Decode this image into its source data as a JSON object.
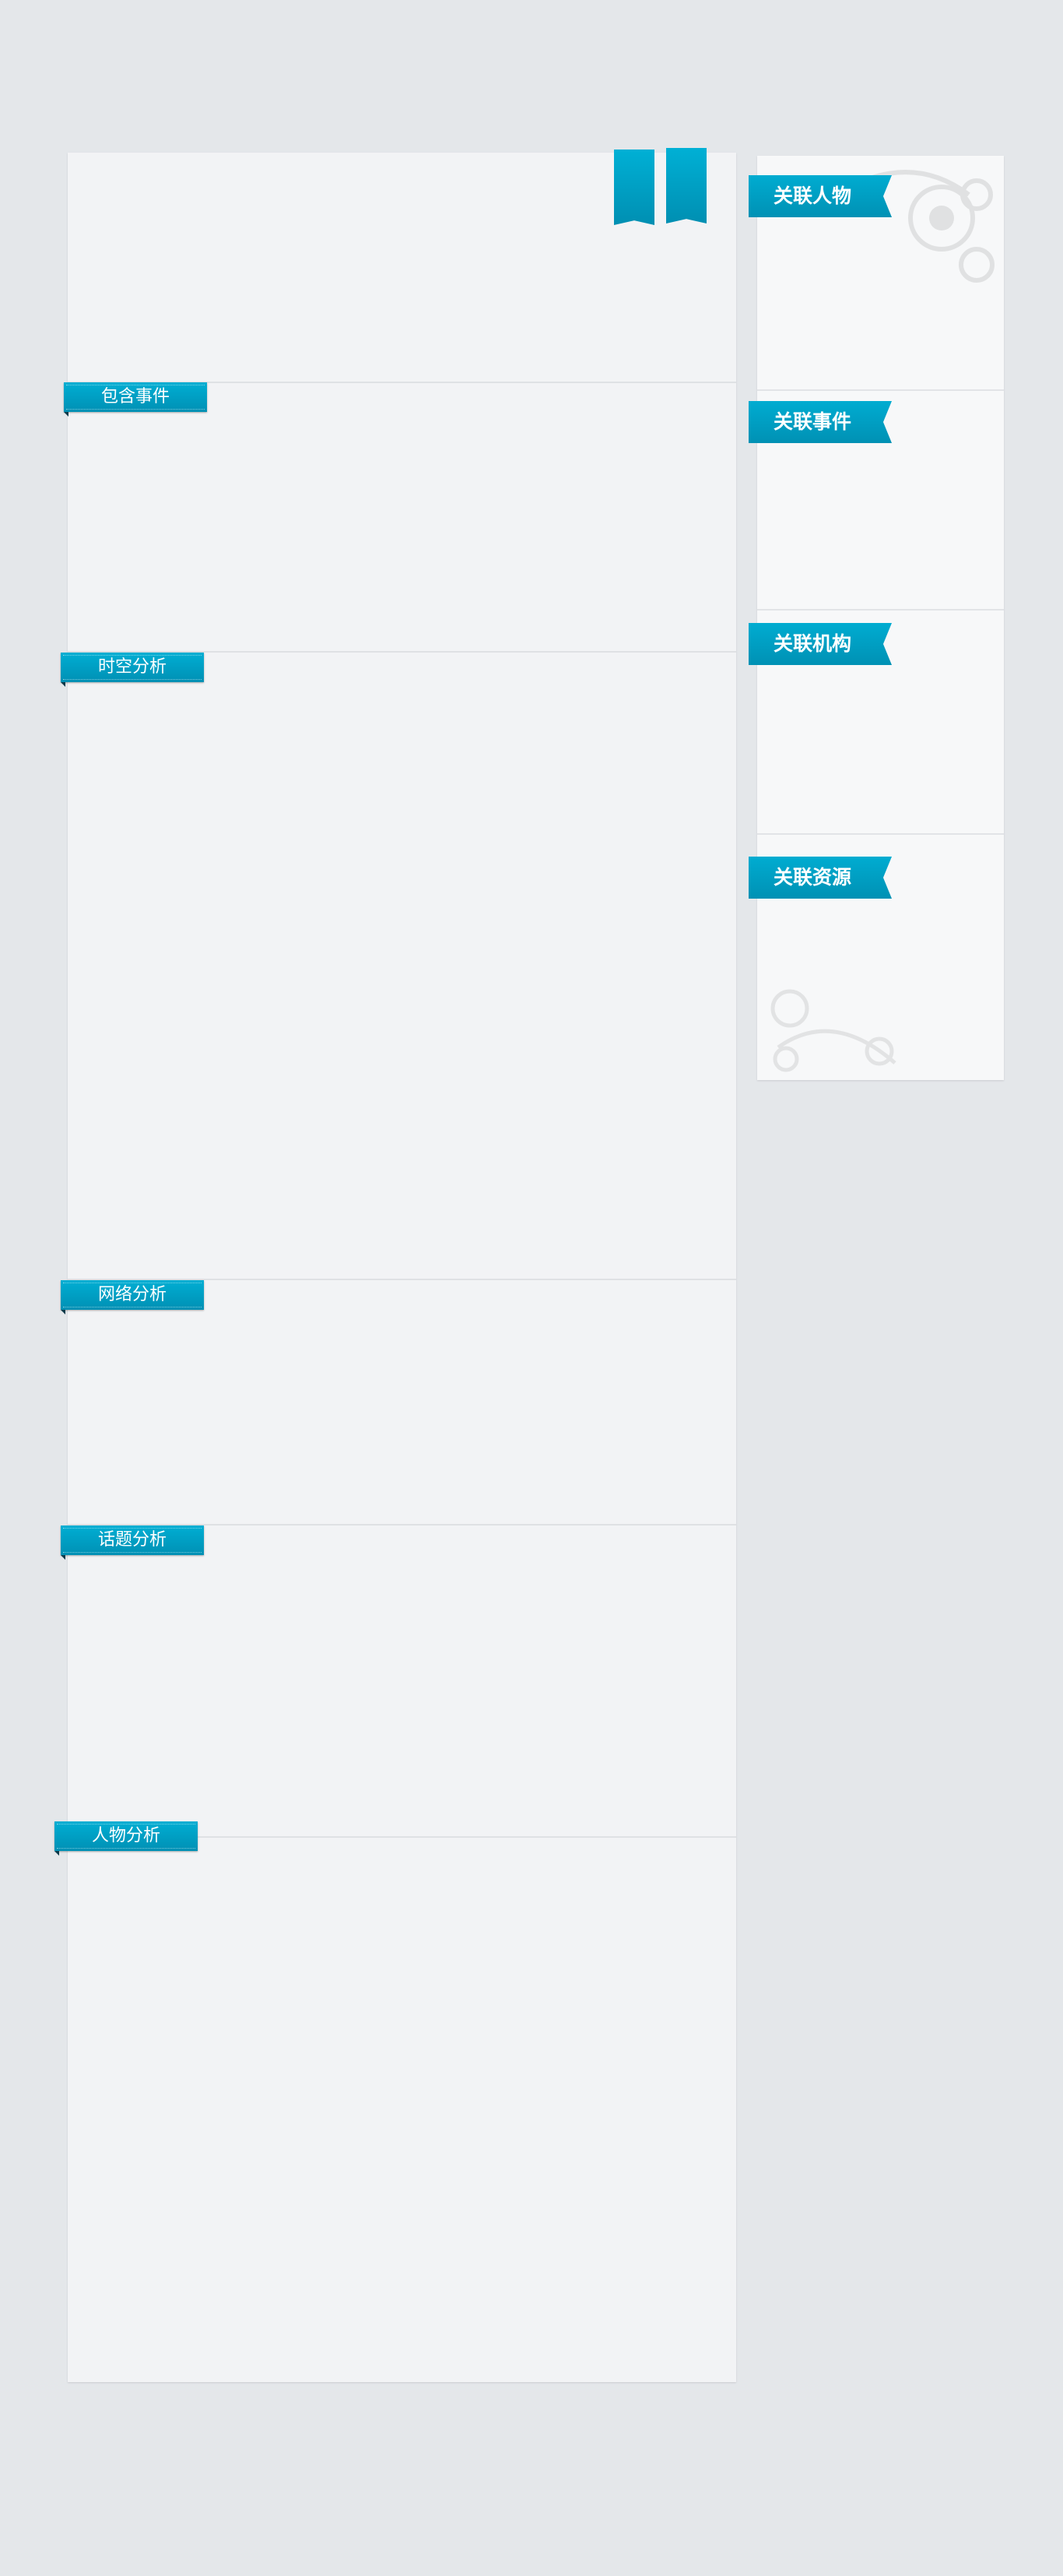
{
  "main_sections": [
    {
      "label": "包含事件"
    },
    {
      "label": "时空分析"
    },
    {
      "label": "网络分析"
    },
    {
      "label": "话题分析"
    },
    {
      "label": "人物分析"
    }
  ],
  "sidebar_sections": [
    {
      "label": "关联人物"
    },
    {
      "label": "关联事件"
    },
    {
      "label": "关联机构"
    },
    {
      "label": "关联资源"
    }
  ],
  "colors": {
    "accent": "#00a3c8",
    "background": "#e4e7ea",
    "panel": "#f2f3f5"
  }
}
